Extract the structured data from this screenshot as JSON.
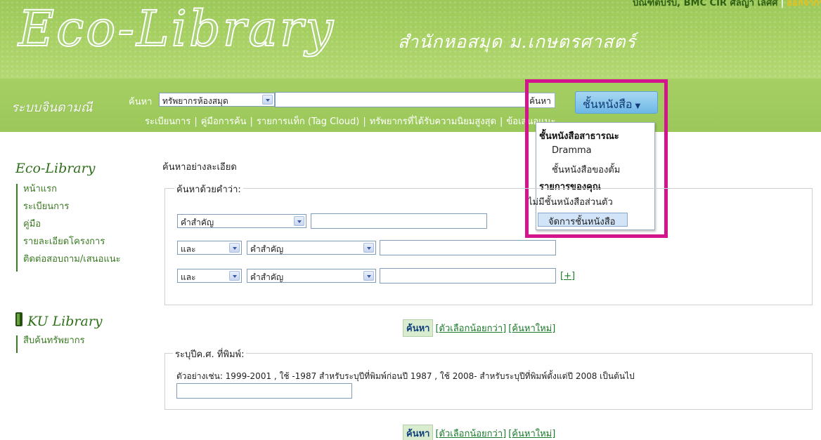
{
  "header": {
    "logo_text": "Eco-Library",
    "logo_subtitle": "สำนักหอสมุด ม.เกษตรศาสตร์",
    "user_name": "บัณฑิตบริบ, BMC CIR ศัลญา เลิศศ",
    "logout_label": "ออกจากระบบ"
  },
  "nav": {
    "system_name": "ระบบจินดามณี",
    "search_label": "ค้นหา",
    "scope_select": "ทรัพยากรห้องสมุด",
    "search_button": "ค้นหา",
    "shelf_button": "ชั้นหนังสือ",
    "links": [
      "ระเบียนการ",
      "คู่มือการค้น",
      "รายการแท็ก (Tag Cloud)",
      "ทรัพยากรที่ได้รับความนิยมสูงสุด",
      "ข้อเสนอแนะ"
    ]
  },
  "shelf_menu": {
    "public_heading": "ชั้นหนังสือสาธารณะ",
    "public_items": [
      "Dramma",
      "ชั้นหนังสือของตั้ม"
    ],
    "your_heading": "รายการของคุณ",
    "your_empty": "ไม่มีชั้นหนังสือส่วนตัว",
    "manage_button": "จัดการชั้นหนังสือ"
  },
  "sidebar": {
    "title": "Eco-Library",
    "items": [
      {
        "label": "หน้าแรก"
      },
      {
        "label": "ระเบียนการ"
      },
      {
        "label": "คู่มือ"
      },
      {
        "label": "รายละเอียดโครงการ"
      },
      {
        "label": "ติดต่อสอบถาม/เสนอแนะ"
      }
    ],
    "ku_title": "KU Library",
    "ku_items": [
      {
        "label": "สืบค้นทรัพยากร"
      }
    ]
  },
  "main": {
    "title": "ค้นหาอย่างละเอียด",
    "keyword_legend": "ค้นหาด้วยคำว่า:",
    "rows": [
      {
        "field": "คำสำคัญ",
        "value": ""
      },
      {
        "operator": "และ",
        "field": "คำสำคัญ",
        "value": ""
      },
      {
        "operator": "และ",
        "field": "คำสำคัญ",
        "value": ""
      }
    ],
    "more_link": "[+]",
    "actions": {
      "search": "ค้นหา",
      "fewer_options": "[ตัวเลือกน้อยกว่า]",
      "new_search": "[ค้นหาใหม่]"
    },
    "year_legend": "ระบุปีค.ศ. ที่พิมพ์:",
    "year_example": "ตัวอย่างเช่น: 1999-2001 , ใช้ -1987 สำหรับระบุปีที่พิมพ์ก่อนปี 1987 , ใช้ 2008- สำหรับระบุปีที่พิมพ์ตั้งแต่ปี 2008 เป็นต้นไป",
    "year_value": ""
  }
}
